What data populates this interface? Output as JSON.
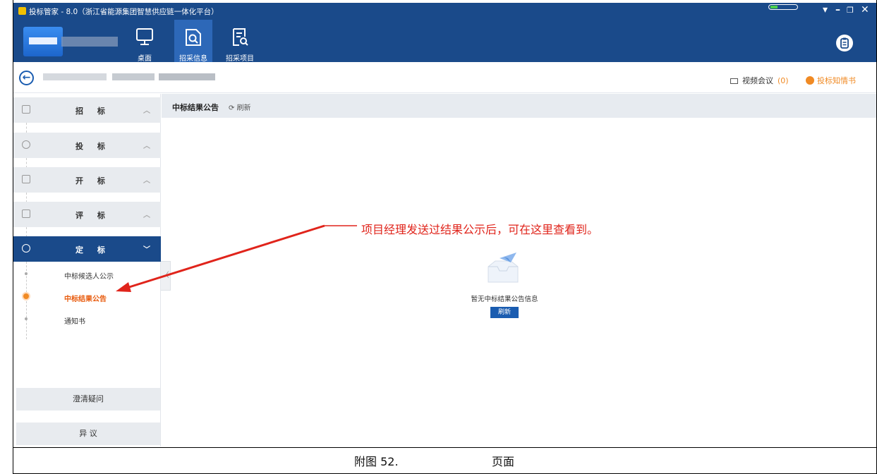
{
  "window": {
    "title": "投标管家 - 8.0（浙江省能源集团智慧供应链一体化平台）",
    "controls": [
      "▾",
      "–",
      "🗗",
      "✕"
    ]
  },
  "topnav": {
    "items": [
      {
        "label": "桌面",
        "icon": "desktop-icon",
        "active": false
      },
      {
        "label": "招采信息",
        "icon": "search-doc-icon",
        "active": true
      },
      {
        "label": "招采项目",
        "icon": "project-list-icon",
        "active": false
      }
    ],
    "help_icon": "clipboard-icon"
  },
  "subbar": {
    "video_meeting_label": "视频会议",
    "video_meeting_count": "(0)",
    "notice_book_label": "投标知情书"
  },
  "sidebar": {
    "sections": [
      {
        "label": "招 标",
        "icon": "doc-icon"
      },
      {
        "label": "投 标",
        "icon": "target-icon"
      },
      {
        "label": "开 标",
        "icon": "mail-open-icon"
      },
      {
        "label": "评 标",
        "icon": "edit-icon"
      },
      {
        "label": "定 标",
        "icon": "check-circle-icon"
      }
    ],
    "sub_items": [
      {
        "label": "中标候选人公示",
        "active": false
      },
      {
        "label": "中标结果公告",
        "active": true
      },
      {
        "label": "通知书",
        "active": false
      }
    ],
    "bottom_buttons": [
      "澄清疑问",
      "异 议"
    ]
  },
  "content": {
    "title": "中标结果公告",
    "refresh_label": "刷新",
    "empty_text": "暂无中标结果公告信息",
    "empty_refresh_label": "刷新"
  },
  "annotation": {
    "text": "项目经理发送过结果公示后，可在这里查看到。",
    "color": "#e0241b"
  },
  "caption": {
    "label": "附图 52.",
    "suffix": "页面"
  },
  "colors": {
    "header": "#1a4a8a",
    "accent_orange": "#f08a24",
    "primary_button": "#1a5cb0"
  }
}
